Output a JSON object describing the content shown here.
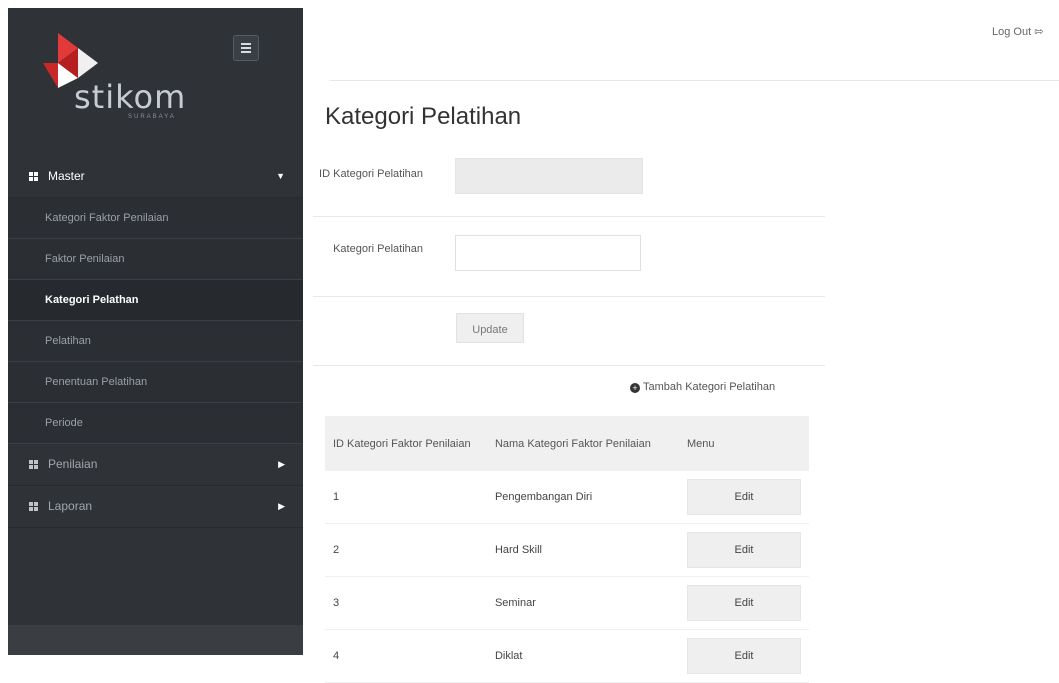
{
  "sidebar": {
    "logo_text": "stikom",
    "logo_sub": "SURABAYA",
    "groups": [
      {
        "label": "Master",
        "items": [
          "Kategori Faktor Penilaian",
          "Faktor Penilaian",
          "Kategori Pelathan",
          "Pelatihan",
          "Penentuan Pelatihan",
          "Periode"
        ]
      },
      {
        "label": "Penilaian"
      },
      {
        "label": "Laporan"
      }
    ]
  },
  "header": {
    "logout_label": "Log Out"
  },
  "page": {
    "title": "Kategori Pelatihan"
  },
  "form": {
    "id_label": "ID Kategori Pelatihan",
    "id_value": "",
    "name_label": "Kategori Pelatihan",
    "name_value": "",
    "update_label": "Update"
  },
  "add_link": "Tambah Kategori Pelatihan",
  "table": {
    "headers": [
      "ID Kategori Faktor Penilaian",
      "Nama Kategori Faktor Penilaian",
      "Menu"
    ],
    "rows": [
      {
        "id": "1",
        "name": "Pengembangan Diri",
        "action": "Edit"
      },
      {
        "id": "2",
        "name": "Hard Skill",
        "action": "Edit"
      },
      {
        "id": "3",
        "name": "Seminar",
        "action": "Edit"
      },
      {
        "id": "4",
        "name": "Diklat",
        "action": "Edit"
      }
    ]
  }
}
